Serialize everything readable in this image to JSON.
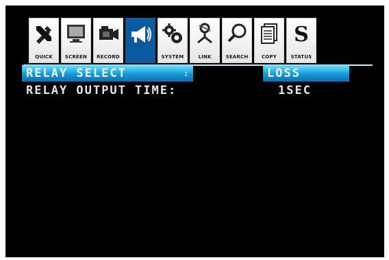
{
  "menu": {
    "tabs": [
      {
        "label": "QUICK",
        "icon": "tools-icon"
      },
      {
        "label": "SCREEN",
        "icon": "monitor-icon"
      },
      {
        "label": "RECORD",
        "icon": "camcorder-icon"
      },
      {
        "label": "",
        "icon": "alarm-speaker-icon",
        "active": true
      },
      {
        "label": "SYSTEM",
        "icon": "gears-icon"
      },
      {
        "label": "LINK",
        "icon": "network-icon"
      },
      {
        "label": "SEARCH",
        "icon": "magnifier-icon"
      },
      {
        "label": "COPY",
        "icon": "copy-icon"
      },
      {
        "label": "STATUS",
        "icon": "status-s-icon"
      }
    ]
  },
  "settings": {
    "rows": [
      {
        "label": "RELAY SELECT",
        "separator": ":",
        "value": "LOSS",
        "selected": true
      },
      {
        "label": "RELAY OUTPUT TIME:",
        "value": "1SEC",
        "selected": false
      }
    ]
  },
  "colors": {
    "background": "#000000",
    "highlight": "#1598d8",
    "active_tab": "#0c5aa0",
    "text": "#e6e6e6"
  }
}
